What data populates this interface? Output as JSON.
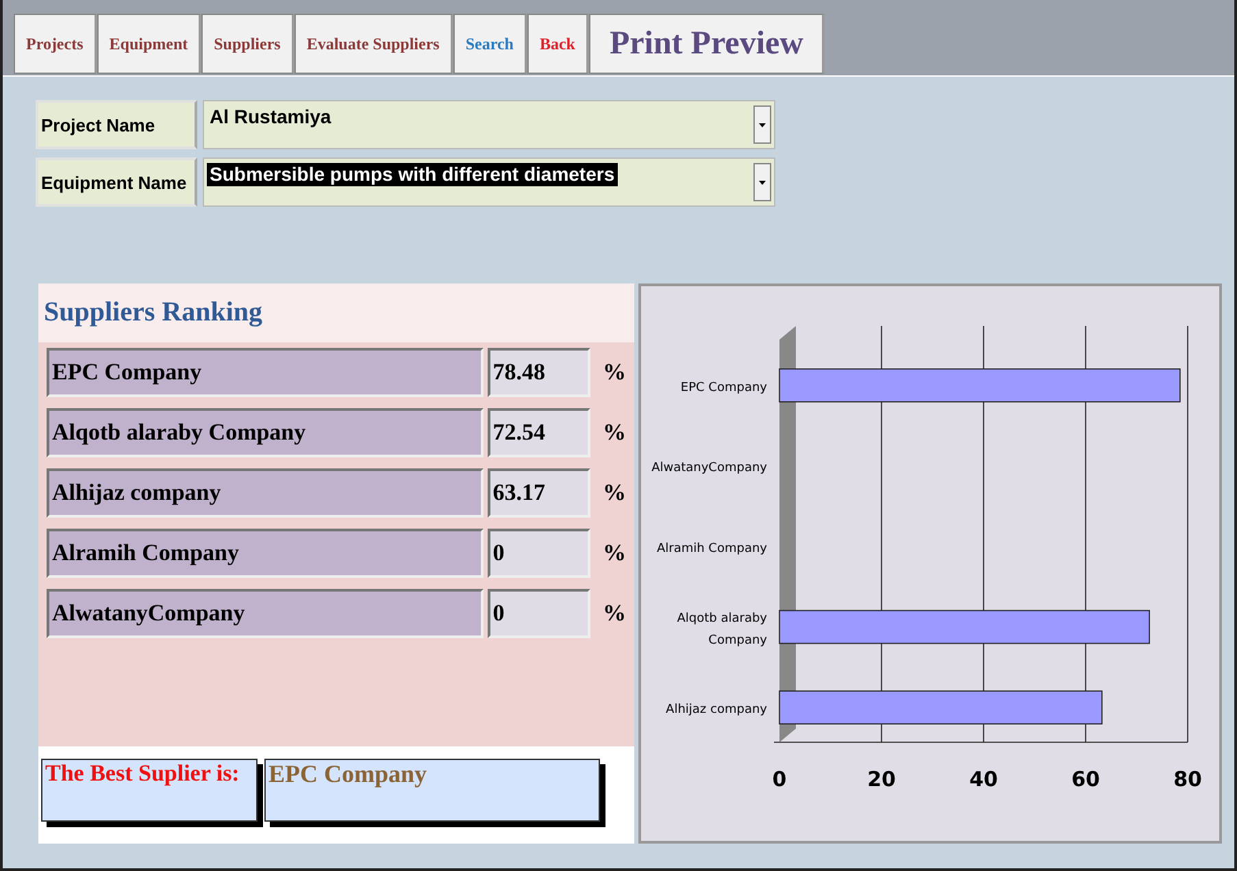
{
  "toolbar": [
    {
      "label": "Projects",
      "kind": "nav"
    },
    {
      "label": "Equipment",
      "kind": "nav"
    },
    {
      "label": "Suppliers",
      "kind": "nav"
    },
    {
      "label": "Evaluate Suppliers",
      "kind": "nav"
    },
    {
      "label": "Search",
      "kind": "search"
    },
    {
      "label": "Back",
      "kind": "back"
    },
    {
      "label": "Print Preview",
      "kind": "title"
    }
  ],
  "fields": [
    {
      "label": "Project Name",
      "value": "Al Rustamiya",
      "text_selected": false
    },
    {
      "label": "Equipment Name",
      "value": "Submersible pumps with different diameters",
      "text_selected": true
    }
  ],
  "ranking": {
    "title": "Suppliers Ranking",
    "rows": [
      {
        "name": "EPC Company",
        "score": "78.48",
        "unit": "%"
      },
      {
        "name": "Alqotb alaraby Company",
        "score": "72.54",
        "unit": "%"
      },
      {
        "name": "Alhijaz company",
        "score": "63.17",
        "unit": "%"
      },
      {
        "name": "Alramih Company",
        "score": "0",
        "unit": "%"
      },
      {
        "name": "AlwatanyCompany",
        "score": "0",
        "unit": "%"
      }
    ],
    "best_label": "The Best Suplier is:",
    "best_value": "EPC Company"
  },
  "chart": {
    "chart_data": {
      "type": "bar",
      "orientation": "horizontal",
      "categories": [
        "EPC Company",
        "AlwatanyCompany",
        "Alramih Company",
        "Alqotb alaraby Company",
        "Alhijaz company"
      ],
      "values": [
        78.5,
        0,
        0,
        72.5,
        63.2
      ],
      "grid": true,
      "xlim": [
        0,
        80
      ],
      "xticks": [
        0,
        20,
        40,
        60,
        80
      ]
    }
  }
}
